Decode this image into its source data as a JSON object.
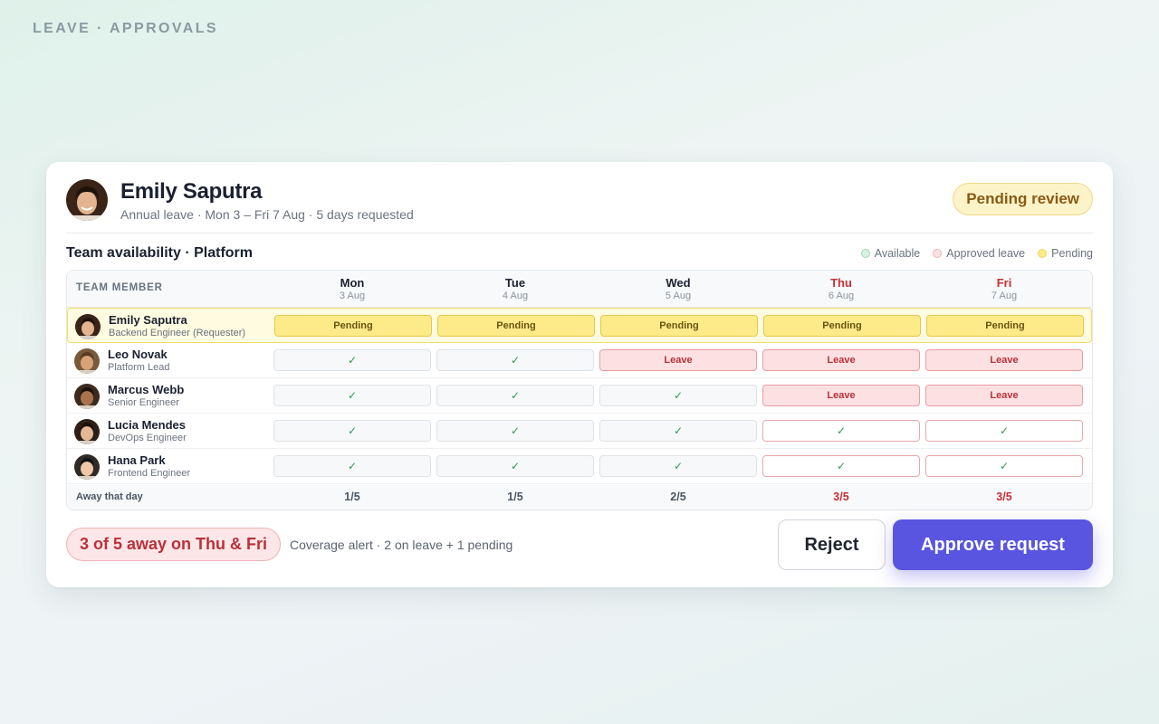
{
  "page_label": "LEAVE · APPROVALS",
  "request": {
    "name": "Emily Saputra",
    "summary": "Annual leave · Mon 3 – Fri 7 Aug · 5 days requested",
    "status": "Pending review"
  },
  "availability": {
    "title": "Team availability · Platform",
    "legend": [
      {
        "label": "Available",
        "color": "#d9f3e3",
        "border": "#9fd8b4"
      },
      {
        "label": "Approved leave",
        "color": "#fde0e2",
        "border": "#f1b2b6"
      },
      {
        "label": "Pending",
        "color": "#fdeb8a",
        "border": "#f0d460"
      }
    ],
    "member_header": "TEAM MEMBER",
    "days": [
      {
        "name": "Mon",
        "date": "3 Aug",
        "alert": false
      },
      {
        "name": "Tue",
        "date": "4 Aug",
        "alert": false
      },
      {
        "name": "Wed",
        "date": "5 Aug",
        "alert": false
      },
      {
        "name": "Thu",
        "date": "6 Aug",
        "alert": true
      },
      {
        "name": "Fri",
        "date": "7 Aug",
        "alert": true
      }
    ],
    "members": [
      {
        "name": "Emily Saputra",
        "role": "Backend Engineer (Requester)",
        "requester": true,
        "cells": [
          {
            "state": "pending",
            "text": "Pending"
          },
          {
            "state": "pending",
            "text": "Pending"
          },
          {
            "state": "pending",
            "text": "Pending"
          },
          {
            "state": "pending",
            "text": "Pending"
          },
          {
            "state": "pending",
            "text": "Pending"
          }
        ]
      },
      {
        "name": "Leo Novak",
        "role": "Platform Lead",
        "requester": false,
        "cells": [
          {
            "state": "available",
            "text": "✓"
          },
          {
            "state": "available",
            "text": "✓"
          },
          {
            "state": "leave",
            "text": "Leave"
          },
          {
            "state": "leave",
            "text": "Leave"
          },
          {
            "state": "leave",
            "text": "Leave"
          }
        ]
      },
      {
        "name": "Marcus Webb",
        "role": "Senior Engineer",
        "requester": false,
        "cells": [
          {
            "state": "available",
            "text": "✓"
          },
          {
            "state": "available",
            "text": "✓"
          },
          {
            "state": "available",
            "text": "✓"
          },
          {
            "state": "leave",
            "text": "Leave"
          },
          {
            "state": "leave",
            "text": "Leave"
          }
        ]
      },
      {
        "name": "Lucia Mendes",
        "role": "DevOps Engineer",
        "requester": false,
        "cells": [
          {
            "state": "available",
            "text": "✓"
          },
          {
            "state": "available",
            "text": "✓"
          },
          {
            "state": "available",
            "text": "✓"
          },
          {
            "state": "available-alert",
            "text": "✓"
          },
          {
            "state": "available-alert",
            "text": "✓"
          }
        ]
      },
      {
        "name": "Hana Park",
        "role": "Frontend Engineer",
        "requester": false,
        "cells": [
          {
            "state": "available",
            "text": "✓"
          },
          {
            "state": "available",
            "text": "✓"
          },
          {
            "state": "available",
            "text": "✓"
          },
          {
            "state": "available-alert",
            "text": "✓"
          },
          {
            "state": "available-alert",
            "text": "✓"
          }
        ]
      }
    ],
    "away_label": "Away that day",
    "away_counts": [
      "1/5",
      "1/5",
      "2/5",
      "3/5",
      "3/5"
    ]
  },
  "footer": {
    "alert_pill": "3 of 5 away on Thu & Fri",
    "alert_note": "Coverage alert · 2 on leave + 1 pending",
    "reject_label": "Reject",
    "approve_label": "Approve request"
  },
  "colors": {
    "accent": "#5a55e0",
    "alert": "#c62f35",
    "pending": "#fdeb8a",
    "leave": "#fde0e2"
  }
}
